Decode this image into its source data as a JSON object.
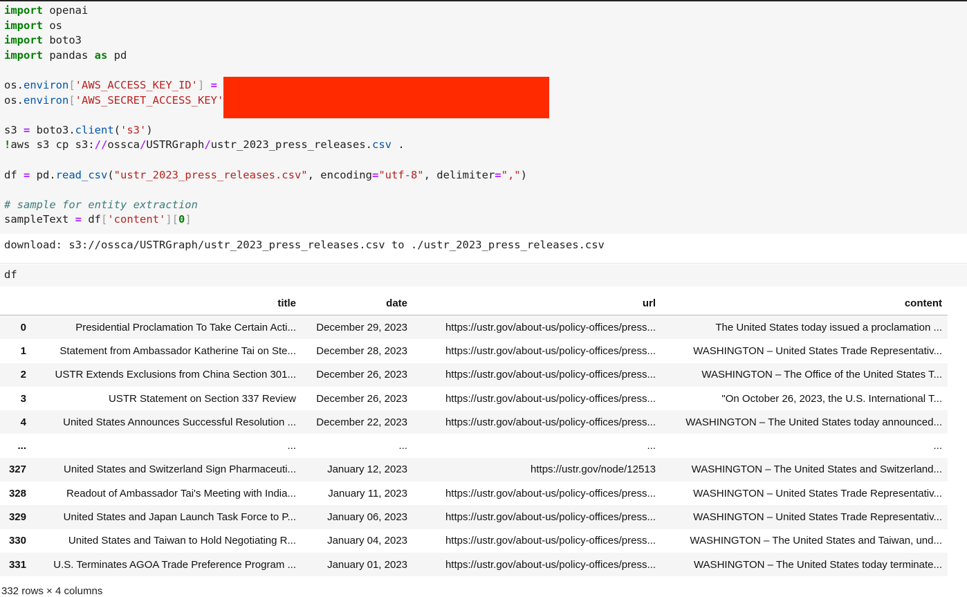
{
  "code_cell_1": {
    "lines": [
      [
        {
          "t": "kw",
          "v": "import"
        },
        {
          "t": "p",
          "v": " openai"
        }
      ],
      [
        {
          "t": "kw",
          "v": "import"
        },
        {
          "t": "p",
          "v": " os"
        }
      ],
      [
        {
          "t": "kw",
          "v": "import"
        },
        {
          "t": "p",
          "v": " boto3"
        }
      ],
      [
        {
          "t": "kw",
          "v": "import"
        },
        {
          "t": "p",
          "v": " pandas "
        },
        {
          "t": "kw",
          "v": "as"
        },
        {
          "t": "p",
          "v": " pd"
        }
      ],
      [],
      [
        {
          "t": "p",
          "v": "os."
        },
        {
          "t": "attr",
          "v": "environ"
        },
        {
          "t": "brk",
          "v": "["
        },
        {
          "t": "str",
          "v": "'AWS_ACCESS_KEY_ID'"
        },
        {
          "t": "brk",
          "v": "]"
        },
        {
          "t": "p",
          "v": " "
        },
        {
          "t": "op",
          "v": "="
        }
      ],
      [
        {
          "t": "p",
          "v": "os."
        },
        {
          "t": "attr",
          "v": "environ"
        },
        {
          "t": "brk",
          "v": "["
        },
        {
          "t": "str",
          "v": "'AWS_SECRET_ACCESS_KEY'"
        }
      ],
      [],
      [
        {
          "t": "p",
          "v": "s3 "
        },
        {
          "t": "op",
          "v": "="
        },
        {
          "t": "p",
          "v": " boto3."
        },
        {
          "t": "attr",
          "v": "client"
        },
        {
          "t": "p",
          "v": "("
        },
        {
          "t": "str",
          "v": "'s3'"
        },
        {
          "t": "p",
          "v": ")"
        }
      ],
      [
        {
          "t": "kw",
          "v": "!"
        },
        {
          "t": "p",
          "v": "aws s3 cp s3:"
        },
        {
          "t": "op",
          "v": "//"
        },
        {
          "t": "p",
          "v": "ossca"
        },
        {
          "t": "op",
          "v": "/"
        },
        {
          "t": "p",
          "v": "USTRGraph"
        },
        {
          "t": "op",
          "v": "/"
        },
        {
          "t": "p",
          "v": "ustr_2023_press_releases."
        },
        {
          "t": "attr",
          "v": "csv"
        },
        {
          "t": "p",
          "v": " ."
        }
      ],
      [],
      [
        {
          "t": "p",
          "v": "df "
        },
        {
          "t": "op",
          "v": "="
        },
        {
          "t": "p",
          "v": " pd."
        },
        {
          "t": "attr",
          "v": "read_csv"
        },
        {
          "t": "p",
          "v": "("
        },
        {
          "t": "str",
          "v": "\"ustr_2023_press_releases.csv\""
        },
        {
          "t": "p",
          "v": ", encoding"
        },
        {
          "t": "op",
          "v": "="
        },
        {
          "t": "str",
          "v": "\"utf-8\""
        },
        {
          "t": "p",
          "v": ", delimiter"
        },
        {
          "t": "op",
          "v": "="
        },
        {
          "t": "str",
          "v": "\",\""
        },
        {
          "t": "p",
          "v": ")"
        }
      ],
      [],
      [
        {
          "t": "cm",
          "v": "# sample for entity extraction"
        }
      ],
      [
        {
          "t": "p",
          "v": "sampleText "
        },
        {
          "t": "op",
          "v": "="
        },
        {
          "t": "p",
          "v": " df"
        },
        {
          "t": "brk",
          "v": "["
        },
        {
          "t": "str",
          "v": "'content'"
        },
        {
          "t": "brk",
          "v": "]["
        },
        {
          "t": "kw",
          "v": "0"
        },
        {
          "t": "brk",
          "v": "]"
        }
      ]
    ]
  },
  "output_1": "download: s3://ossca/USTRGraph/ustr_2023_press_releases.csv to ./ustr_2023_press_releases.csv",
  "code_cell_2": "df",
  "dataframe": {
    "columns": [
      "",
      "title",
      "date",
      "url",
      "content"
    ],
    "rows": [
      [
        "0",
        "Presidential Proclamation To Take Certain Acti...",
        "December 29, 2023",
        "https://ustr.gov/about-us/policy-offices/press...",
        "The United States today issued a proclamation ..."
      ],
      [
        "1",
        "Statement from Ambassador Katherine Tai on Ste...",
        "December 28, 2023",
        "https://ustr.gov/about-us/policy-offices/press...",
        "WASHINGTON – United States Trade Representativ..."
      ],
      [
        "2",
        "USTR Extends Exclusions from China Section 301...",
        "December 26, 2023",
        "https://ustr.gov/about-us/policy-offices/press...",
        "WASHINGTON – The Office of the United States T..."
      ],
      [
        "3",
        "USTR Statement on Section 337 Review",
        "December 26, 2023",
        "https://ustr.gov/about-us/policy-offices/press...",
        "\"On October 26, 2023, the U.S. International T..."
      ],
      [
        "4",
        "United States Announces Successful Resolution ...",
        "December 22, 2023",
        "https://ustr.gov/about-us/policy-offices/press...",
        "WASHINGTON – The United States today announced..."
      ],
      [
        "...",
        "...",
        "...",
        "...",
        "..."
      ],
      [
        "327",
        "United States and Switzerland Sign Pharmaceuti...",
        "January 12, 2023",
        "https://ustr.gov/node/12513",
        "WASHINGTON – The United States and Switzerland..."
      ],
      [
        "328",
        "Readout of Ambassador Tai's Meeting with India...",
        "January 11, 2023",
        "https://ustr.gov/about-us/policy-offices/press...",
        "WASHINGTON – United States Trade Representativ..."
      ],
      [
        "329",
        "United States and Japan Launch Task Force to P...",
        "January 06, 2023",
        "https://ustr.gov/about-us/policy-offices/press...",
        "WASHINGTON – United States Trade Representativ..."
      ],
      [
        "330",
        "United States and Taiwan to Hold Negotiating R...",
        "January 04, 2023",
        "https://ustr.gov/about-us/policy-offices/press...",
        "WASHINGTON – The United States and Taiwan, und..."
      ],
      [
        "331",
        "U.S. Terminates AGOA Trade Preference Program ...",
        "January 01, 2023",
        "https://ustr.gov/about-us/policy-offices/press...",
        "WASHINGTON – The United States today terminate..."
      ]
    ]
  },
  "footer": "332 rows × 4 columns",
  "colors": {
    "redaction": "#ff2a00",
    "keyword": "#008000",
    "string": "#ba2121",
    "cell_bg": "#f6f6f6"
  }
}
